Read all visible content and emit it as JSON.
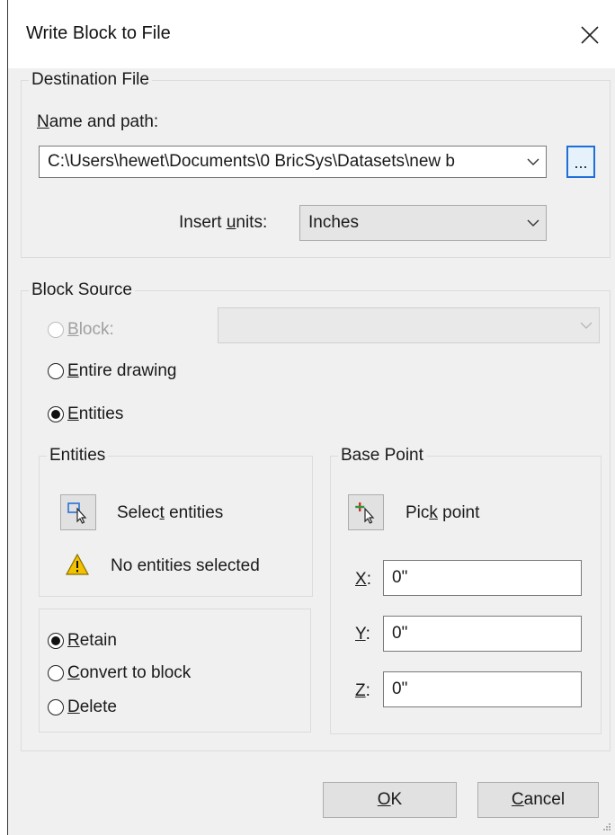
{
  "dialog": {
    "title": "Write Block to File",
    "close_glyph": "✕"
  },
  "destination": {
    "legend": "Destination File",
    "name_path_label_mn": "N",
    "name_path_label_rest": "ame and path:",
    "path_value": "C:\\Users\\hewet\\Documents\\0 BricSys\\Datasets\\new b",
    "browse_label": "...",
    "insert_units_pre": "Insert ",
    "insert_units_mn": "u",
    "insert_units_post": "nits:",
    "insert_units_value": "Inches"
  },
  "block_source": {
    "legend": "Block Source",
    "block_mn": "B",
    "block_rest": "lock:",
    "block_value": "",
    "entire_mn": "E",
    "entire_rest": "ntire drawing",
    "entities_mn": "E",
    "entities_rest": "ntities",
    "selected_option": "entities"
  },
  "entities_group": {
    "legend": "Entities",
    "select_pre": "Selec",
    "select_mn": "t",
    "select_post": " entities",
    "status_text": "No entities selected",
    "retain_mn": "R",
    "retain_rest": "etain",
    "convert_mn": "C",
    "convert_rest": "onvert to block",
    "delete_mn": "D",
    "delete_rest": "elete",
    "selected_action": "retain"
  },
  "base_point": {
    "legend": "Base Point",
    "pick_pre": "Pic",
    "pick_mn": "k",
    "pick_post": " point",
    "x_mn": "X",
    "x_value": "0\"",
    "y_mn": "Y",
    "y_value": "0\"",
    "z_mn": "Z",
    "z_value": "0\""
  },
  "footer": {
    "ok_mn": "O",
    "ok_rest": "K",
    "cancel_mn": "C",
    "cancel_rest": "ancel"
  },
  "colors": {
    "dialog_bg": "#f0f0f0",
    "accent": "#1e6fd8",
    "pick_plus": "#d12b2b",
    "warning": "#f2c200"
  }
}
